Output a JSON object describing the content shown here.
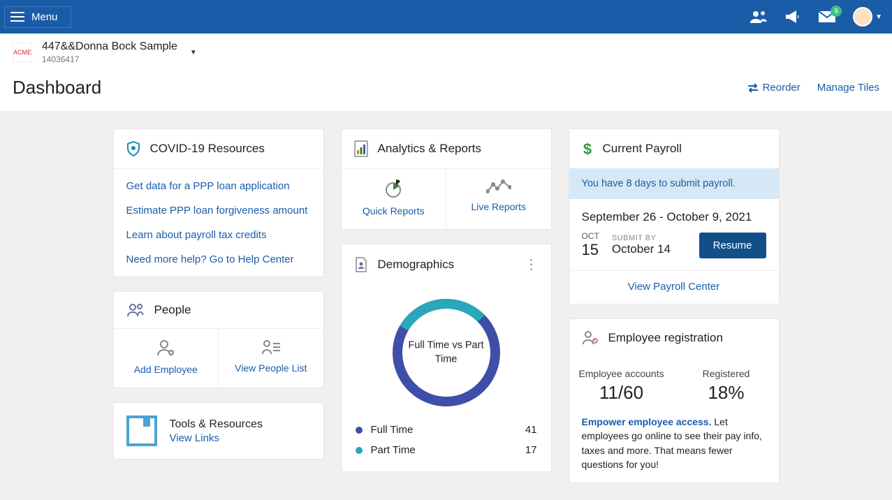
{
  "topbar": {
    "menu_label": "Menu",
    "badge_count": "9"
  },
  "company": {
    "logo_text": "ACME",
    "name": "447&&Donna Bock Sample",
    "id": "14036417"
  },
  "dashboard": {
    "title": "Dashboard",
    "reorder": "Reorder",
    "manage": "Manage Tiles"
  },
  "covid": {
    "title": "COVID-19 Resources",
    "links": [
      "Get data for a PPP loan application",
      "Estimate PPP loan forgiveness amount",
      "Learn about payroll tax credits",
      "Need more help? Go to Help Center"
    ]
  },
  "people": {
    "title": "People",
    "add": "Add Employee",
    "view": "View People List"
  },
  "tools": {
    "title": "Tools & Resources",
    "view_links": "View Links"
  },
  "analytics": {
    "title": "Analytics & Reports",
    "quick": "Quick Reports",
    "live": "Live Reports"
  },
  "demographics": {
    "title": "Demographics",
    "center": "Full Time vs Part Time",
    "rows": [
      {
        "label": "Full Time",
        "value": "41",
        "color": "#3f4fa8"
      },
      {
        "label": "Part Time",
        "value": "17",
        "color": "#2aa7b8"
      }
    ]
  },
  "payroll": {
    "title": "Current Payroll",
    "banner": "You have 8 days to submit payroll.",
    "period": "September 26 - October 9, 2021",
    "check_month": "OCT",
    "check_day": "15",
    "submit_label": "SUBMIT BY",
    "submit_date": "October 14",
    "resume": "Resume",
    "center_link": "View Payroll Center"
  },
  "empreg": {
    "title": "Employee registration",
    "accounts_label": "Employee accounts",
    "accounts_value": "11/60",
    "registered_label": "Registered",
    "registered_value": "18%",
    "lead": "Empower employee access.",
    "body": " Let employees go online to see their pay info, taxes and more. That means fewer questions for you!"
  },
  "chart_data": {
    "type": "pie",
    "title": "Full Time vs Part Time",
    "series": [
      {
        "name": "Full Time",
        "value": 41,
        "color": "#3f4fa8"
      },
      {
        "name": "Part Time",
        "value": 17,
        "color": "#2aa7b8"
      }
    ]
  }
}
